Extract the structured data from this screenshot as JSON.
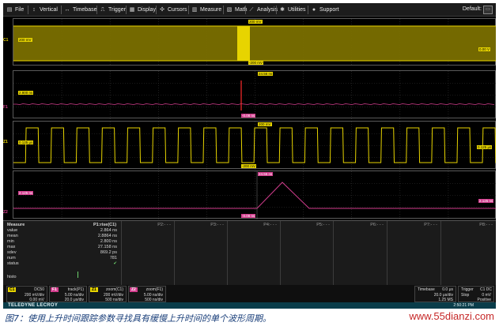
{
  "menu": {
    "items": [
      {
        "label": "File",
        "icon": "file-icon"
      },
      {
        "label": "Vertical",
        "icon": "vertical-icon"
      },
      {
        "label": "Timebase",
        "icon": "timebase-icon"
      },
      {
        "label": "Trigger",
        "icon": "trigger-icon"
      },
      {
        "label": "Display",
        "icon": "display-icon"
      },
      {
        "label": "Cursors",
        "icon": "cursors-icon"
      },
      {
        "label": "Measure",
        "icon": "measure-icon"
      },
      {
        "label": "Math",
        "icon": "math-icon"
      },
      {
        "label": "Analysis",
        "icon": "analysis-icon"
      },
      {
        "label": "Utilities",
        "icon": "utilities-icon"
      },
      {
        "label": "Support",
        "icon": "support-icon"
      }
    ],
    "default_label": "Default:"
  },
  "colors": {
    "c1": "#e7d400",
    "math": "#d23d8d",
    "grid": "#3a3a3a",
    "panel": "#1b1b1b"
  },
  "traces": {
    "c1_tag": "C1",
    "f1_tag": "F1",
    "z1_tag": "Z1",
    "z2_tag": "Z2",
    "g1_top": "200 mV",
    "g1_bottom": "-200 mV",
    "g1_left": "200 mV",
    "g1_right": "0.00 V",
    "g2_top": "24.56 ns",
    "g2_bottom": "-0.08 ns",
    "g2_left": "2.800 ns",
    "g3_top": "200 mV",
    "g3_bottom": "-200 mV",
    "g3_left": "0.125 μs",
    "g3_right": "0.125 μs",
    "g4_top": "24.56 ns",
    "g4_bottom": "-0.08 ns",
    "g4_left": "2.125 ns",
    "g4_right": "2.125 ns"
  },
  "measure": {
    "title": "Measure",
    "rows": [
      "value",
      "mean",
      "min",
      "max",
      "sdev",
      "num",
      "status"
    ],
    "histo": "histo",
    "p1_title": "P1:rise(C1)",
    "p1_values": [
      "2.864 ns",
      "2.8864 ns",
      "2.800 ns",
      "27.158 ns",
      "869.2 ps",
      "781"
    ],
    "status_mark": "✔",
    "empty_params": [
      "P2:- - -",
      "P3:- - -",
      "P4:- - -",
      "P5:- - -",
      "P6:- - -",
      "P7:- - -",
      "P8:- - -"
    ]
  },
  "descriptors": {
    "c1": {
      "tag": "C1",
      "title": "DC50",
      "line1": "200 mV/div",
      "line2": "0.00 mV"
    },
    "f1": {
      "tag": "F1",
      "title": "track(P1)",
      "line1": "5.00 ns/div",
      "line2": "20.0 μs/div"
    },
    "z1": {
      "tag": "Z1",
      "title": "zoom(C1)",
      "line1": "200 mV/div",
      "line2": "500 ns/div"
    },
    "z2": {
      "tag": "Z2",
      "title": "zoom(F1)",
      "line1": "5.00 ns/div",
      "line2": "500 ns/div"
    },
    "timebase": {
      "title": "Timebase",
      "offset": "0.0 μs",
      "line1": "20.0 μs/div",
      "line2": "1.25 MS"
    },
    "trigger": {
      "title": "Trigger",
      "tag": "C1 DC",
      "line1": "Stop",
      "line2": "Positive",
      "level": "0 mV"
    }
  },
  "brand": "TELEDYNE LECROY",
  "clock": "2:50:21 PM",
  "caption": "图7：使用上升时间跟踪参数寻找具有缓慢上升时间的单个波形周期。",
  "watermark": "www.55dianzi.com"
}
